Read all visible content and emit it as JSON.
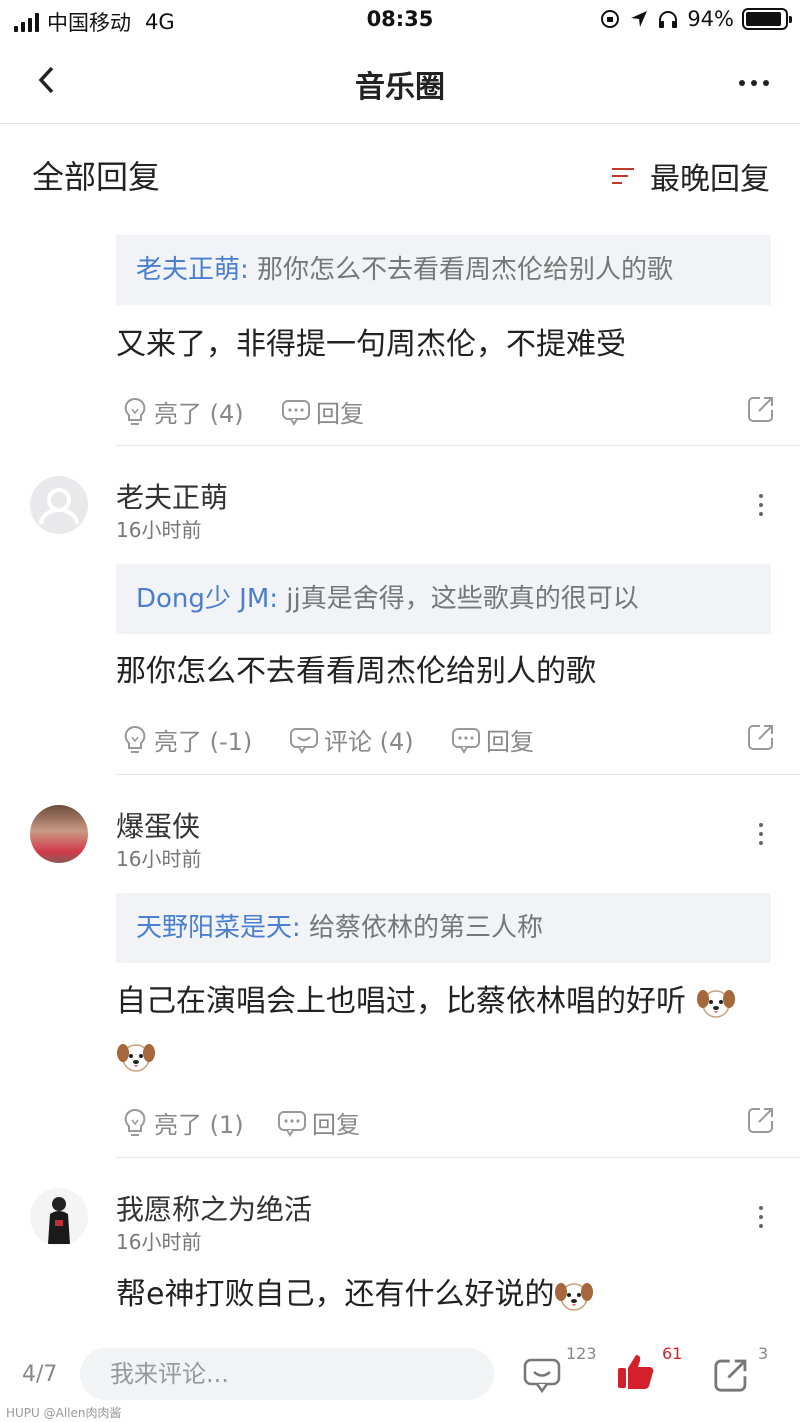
{
  "status_bar": {
    "carrier": "中国移动",
    "network": "4G",
    "time": "08:35",
    "battery": "94%"
  },
  "header": {
    "title": "音乐圈"
  },
  "sort_header": {
    "all_replies": "全部回复",
    "sort_label": "最晚回复"
  },
  "comments": [
    {
      "quote_name": "老夫正萌:",
      "quote_text": " 那你怎么不去看看周杰伦给别人的歌",
      "body": "又来了，非得提一句周杰伦，不提难受",
      "like": "亮了 (4)",
      "reply": "回复"
    },
    {
      "username": "老夫正萌",
      "time": "16小时前",
      "quote_name": "Dong少 JM:",
      "quote_text": " jj真是舍得，这些歌真的很可以",
      "body": "那你怎么不去看看周杰伦给别人的歌",
      "like": "亮了 (-1)",
      "comment": "评论 (4)",
      "reply": "回复"
    },
    {
      "username": "爆蛋侠",
      "time": "16小时前",
      "quote_name": "天野阳菜是天:",
      "quote_text": " 给蔡依林的第三人称",
      "body": "自己在演唱会上也唱过，比蔡依林唱的好听",
      "like": "亮了 (1)",
      "reply": "回复"
    },
    {
      "username": "我愿称之为绝活",
      "time": "16小时前",
      "body": "帮e神打败自己，还有什么好说的"
    }
  ],
  "bottom_bar": {
    "page": "4/7",
    "placeholder": "我来评论...",
    "comments_count": "123",
    "likes_count": "61",
    "share_count": "3"
  },
  "watermark": "HUPU @Allen肉肉酱",
  "colors": {
    "link_blue": "#4a7fd0",
    "like_red": "#d4202a",
    "quote_bg": "#f2f3f6"
  }
}
